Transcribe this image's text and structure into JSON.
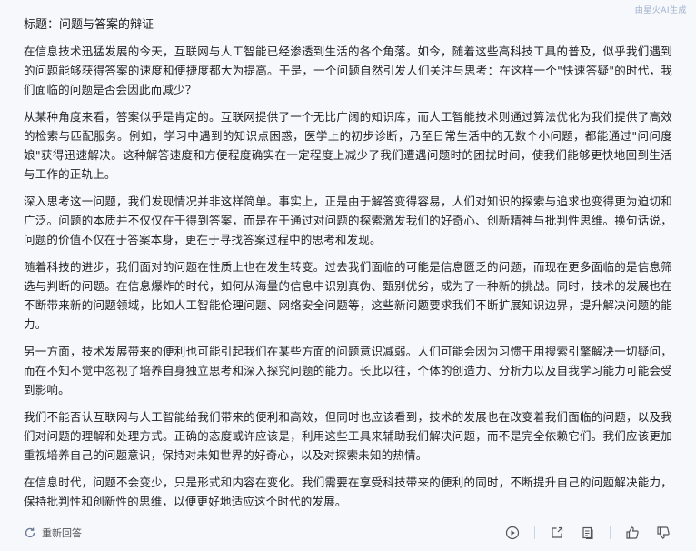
{
  "watermark": "由星火AI生成",
  "title": "标题：问题与答案的辩证",
  "paragraphs": [
    "在信息技术迅猛发展的今天，互联网与人工智能已经渗透到生活的各个角落。如今，随着这些高科技工具的普及，似乎我们遇到的问题能够获得答案的速度和便捷度都大为提高。于是，一个问题自然引发人们关注与思考：在这样一个\"快速答疑\"的时代，我们面临的问题是否会因此而减少？",
    "从某种角度来看，答案似乎是肯定的。互联网提供了一个无比广阔的知识库，而人工智能技术则通过算法优化为我们提供了高效的检索与匹配服务。例如，学习中遇到的知识点困惑，医学上的初步诊断，乃至日常生活中的无数个小问题，都能通过\"问问度娘\"获得迅速解决。这种解答速度和方便程度确实在一定程度上减少了我们遭遇问题时的困扰时间，使我们能够更快地回到生活与工作的正轨上。",
    "深入思考这一问题，我们发现情况并非这样简单。事实上，正是由于解答变得容易，人们对知识的探索与追求也变得更为迫切和广泛。问题的本质并不仅仅在于得到答案，而是在于通过对问题的探索激发我们的好奇心、创新精神与批判性思维。换句话说，问题的价值不仅在于答案本身，更在于寻找答案过程中的思考和发现。",
    "随着科技的进步，我们面对的问题在性质上也在发生转变。过去我们面临的可能是信息匮乏的问题，而现在更多面临的是信息筛选与判断的问题。在信息爆炸的时代，如何从海量的信息中识别真伪、甄别优劣，成为了一种新的挑战。同时，技术的发展也在不断带来新的问题领域，比如人工智能伦理问题、网络安全问题等，这些新问题要求我们不断扩展知识边界，提升解决问题的能力。",
    "另一方面，技术发展带来的便利也可能引起我们在某些方面的问题意识减弱。人们可能会因为习惯于用搜索引擎解决一切疑问，而在不知不觉中忽视了培养自身独立思考和深入探究问题的能力。长此以往，个体的创造力、分析力以及自我学习能力可能会受到影响。",
    "我们不能否认互联网与人工智能给我们带来的便利和高效，但同时也应该看到，技术的发展也在改变着我们面临的问题，以及我们对问题的理解和处理方式。正确的态度或许应该是，利用这些工具来辅助我们解决问题，而不是完全依赖它们。我们应该更加重视培养自己的问题意识，保持对未知世界的好奇心，以及对探索未知的热情。",
    "在信息时代，问题不会变少，只是形式和内容在变化。我们需要在享受科技带来的便利的同时，不断提升自己的问题解决能力，保持批判性和创新性的思维，以便更好地适应这个时代的发展。"
  ],
  "footer": {
    "regenerate_label": "重新回答",
    "icons": [
      "refresh-icon",
      "play-icon",
      "share-icon",
      "copy-icon",
      "thumbs-up-icon",
      "thumbs-down-icon"
    ]
  }
}
